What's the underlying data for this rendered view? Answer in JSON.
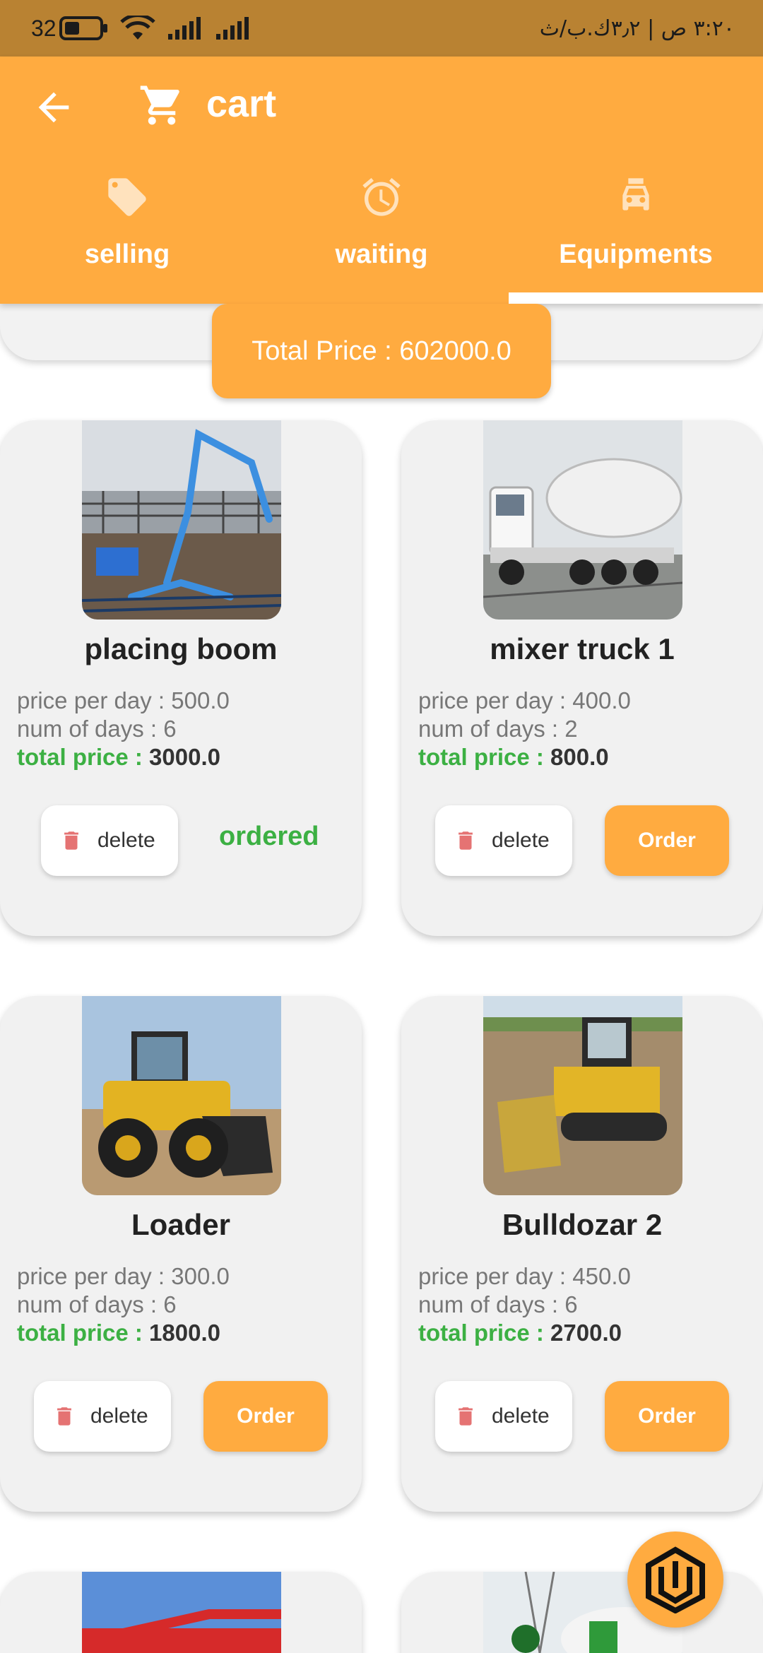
{
  "status_bar": {
    "battery": "32",
    "time_text": "٣:٢٠ ص | ٣٫٢ك.ب/ث"
  },
  "app_bar": {
    "title": "cart",
    "color": "#FFAB40"
  },
  "tabs": [
    {
      "label": "selling",
      "icon": "tag-icon",
      "active": false
    },
    {
      "label": "waiting",
      "icon": "alarm-icon",
      "active": false
    },
    {
      "label": "Equipments",
      "icon": "car-rental-icon",
      "active": true
    }
  ],
  "summary": {
    "total_price": "Total Price : 602000.0"
  },
  "cards": [
    {
      "name": "placing boom",
      "price_per_day": "price per day : 500.0",
      "num_days": "num of days : 6",
      "total_label": "total price :",
      "total_value": "3000.0",
      "delete_label": "delete",
      "status": "ordered"
    },
    {
      "name": "mixer truck 1",
      "price_per_day": "price per day : 400.0",
      "num_days": "num of days : 2",
      "total_label": "total price :",
      "total_value": "800.0",
      "delete_label": "delete",
      "order_label": "Order"
    },
    {
      "name": "Loader",
      "price_per_day": "price per day : 300.0",
      "num_days": "num of days : 6",
      "total_label": "total price :",
      "total_value": "1800.0",
      "delete_label": "delete",
      "order_label": "Order"
    },
    {
      "name": "Bulldozar 2",
      "price_per_day": "price per day : 450.0",
      "num_days": "num of days : 6",
      "total_label": "total price :",
      "total_value": "2700.0",
      "delete_label": "delete",
      "order_label": "Order"
    }
  ],
  "colors": {
    "accent": "#FFAB40",
    "status_bar": "#B98232",
    "total_green": "#3cb043",
    "delete_red": "#E57373"
  }
}
